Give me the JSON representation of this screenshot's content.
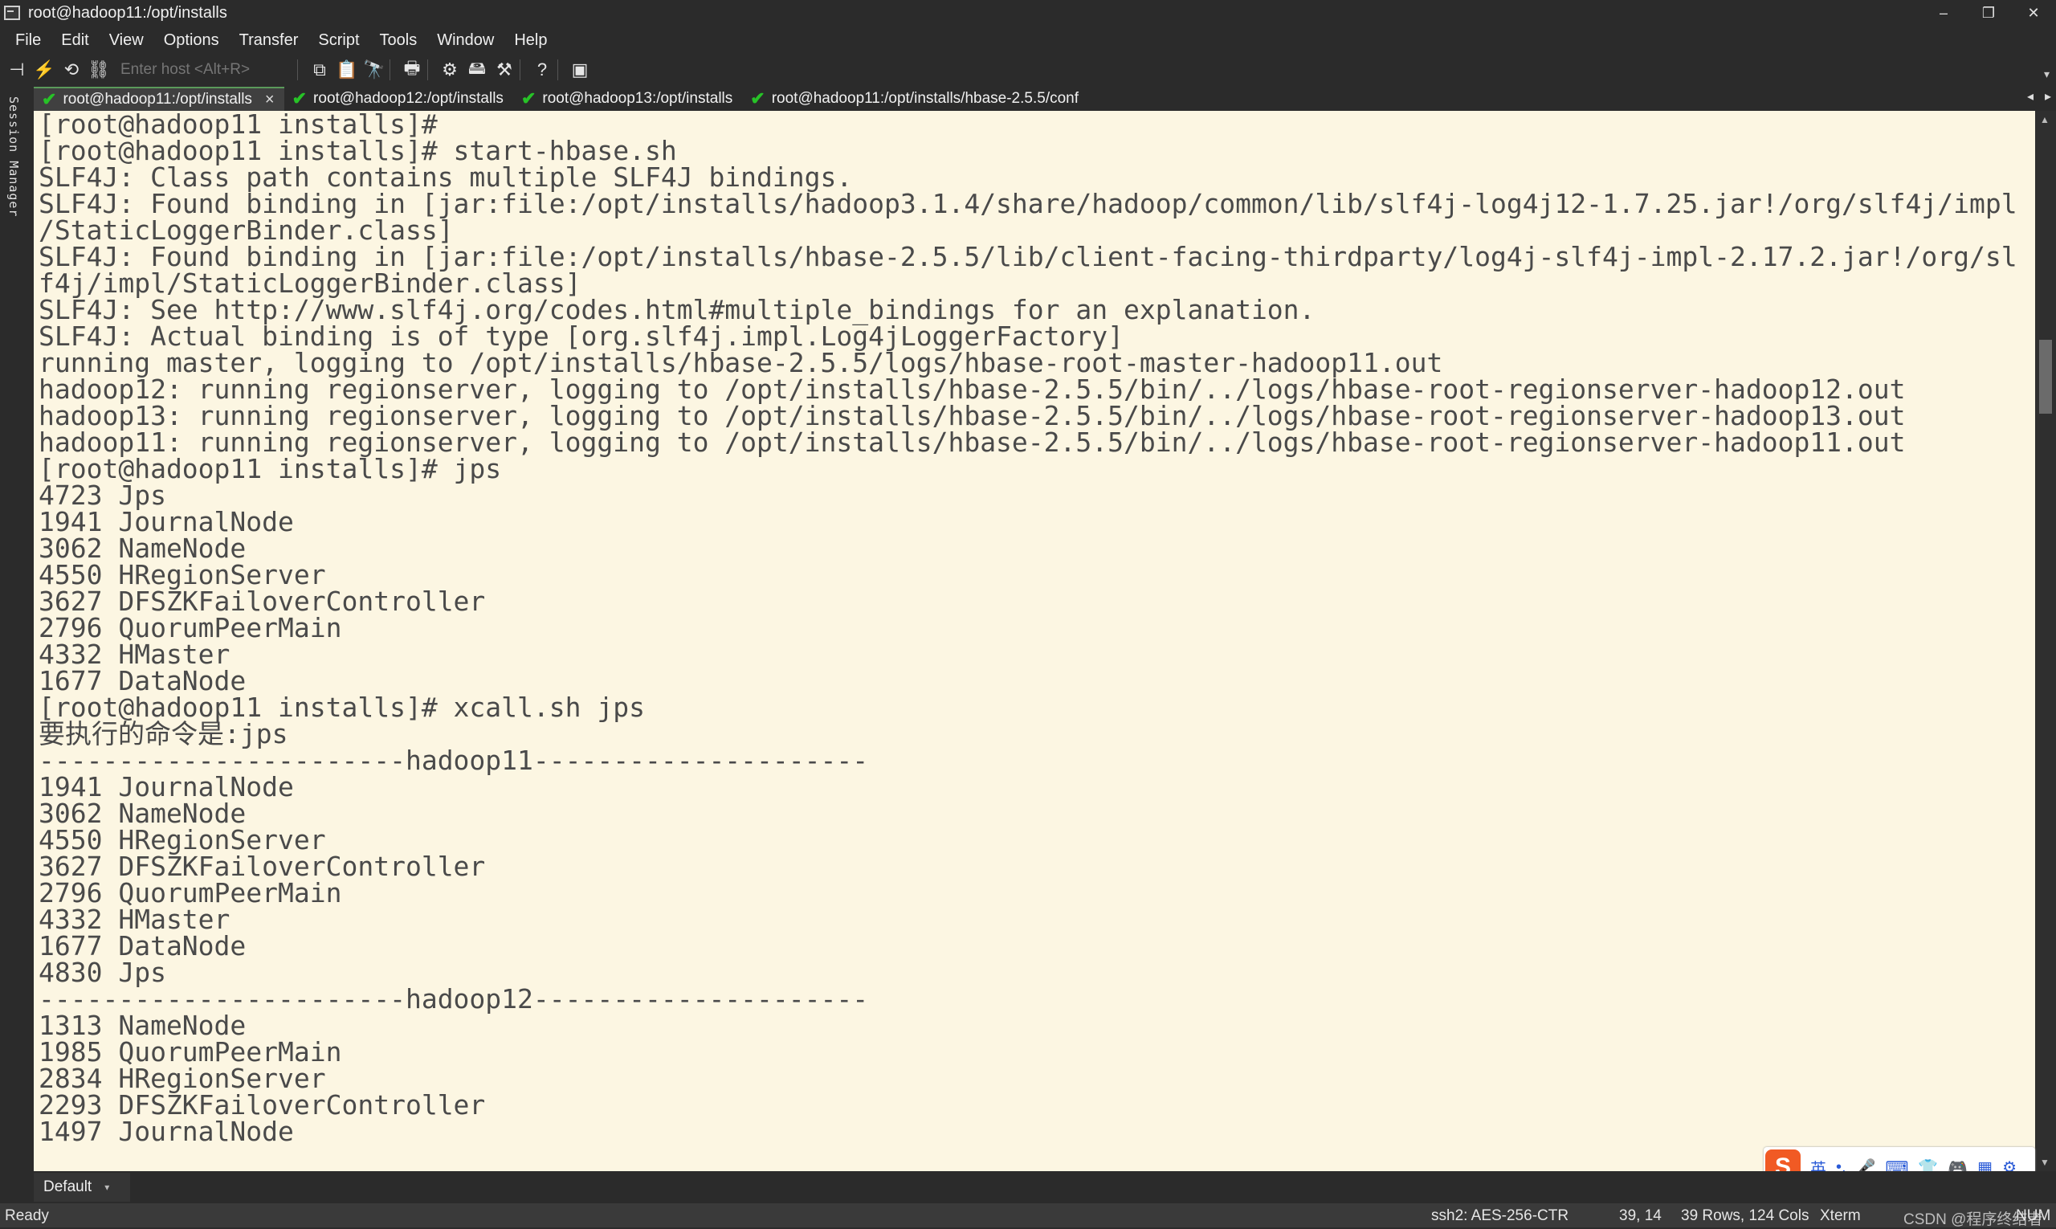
{
  "window": {
    "title": "root@hadoop11:/opt/installs",
    "controls": [
      "–",
      "❐",
      "✕"
    ]
  },
  "menu": [
    "File",
    "Edit",
    "View",
    "Options",
    "Transfer",
    "Script",
    "Tools",
    "Window",
    "Help"
  ],
  "toolbar": {
    "host_placeholder": "Enter host <Alt+R>",
    "more": "▾"
  },
  "sidebar": {
    "label": "Session Manager"
  },
  "tabs": [
    {
      "label": "root@hadoop11:/opt/installs",
      "active": true,
      "close": "×"
    },
    {
      "label": "root@hadoop12:/opt/installs",
      "active": false
    },
    {
      "label": "root@hadoop13:/opt/installs",
      "active": false
    },
    {
      "label": "root@hadoop11:/opt/installs/hbase-2.5.5/conf",
      "active": false
    }
  ],
  "tab_nav": {
    "prev": "◂",
    "next": "▸"
  },
  "terminal": {
    "lines": [
      "[root@hadoop11 installs]#",
      "[root@hadoop11 installs]# start-hbase.sh",
      "SLF4J: Class path contains multiple SLF4J bindings.",
      "SLF4J: Found binding in [jar:file:/opt/installs/hadoop3.1.4/share/hadoop/common/lib/slf4j-log4j12-1.7.25.jar!/org/slf4j/impl",
      "/StaticLoggerBinder.class]",
      "SLF4J: Found binding in [jar:file:/opt/installs/hbase-2.5.5/lib/client-facing-thirdparty/log4j-slf4j-impl-2.17.2.jar!/org/sl",
      "f4j/impl/StaticLoggerBinder.class]",
      "SLF4J: See http://www.slf4j.org/codes.html#multiple_bindings for an explanation.",
      "SLF4J: Actual binding is of type [org.slf4j.impl.Log4jLoggerFactory]",
      "running master, logging to /opt/installs/hbase-2.5.5/logs/hbase-root-master-hadoop11.out",
      "hadoop12: running regionserver, logging to /opt/installs/hbase-2.5.5/bin/../logs/hbase-root-regionserver-hadoop12.out",
      "hadoop13: running regionserver, logging to /opt/installs/hbase-2.5.5/bin/../logs/hbase-root-regionserver-hadoop13.out",
      "hadoop11: running regionserver, logging to /opt/installs/hbase-2.5.5/bin/../logs/hbase-root-regionserver-hadoop11.out",
      "[root@hadoop11 installs]# jps",
      "4723 Jps",
      "1941 JournalNode",
      "3062 NameNode",
      "4550 HRegionServer",
      "3627 DFSZKFailoverController",
      "2796 QuorumPeerMain",
      "4332 HMaster",
      "1677 DataNode",
      "[root@hadoop11 installs]# xcall.sh jps",
      "要执行的命令是:jps",
      "-----------------------hadoop11---------------------",
      "1941 JournalNode",
      "3062 NameNode",
      "4550 HRegionServer",
      "3627 DFSZKFailoverController",
      "2796 QuorumPeerMain",
      "4332 HMaster",
      "1677 DataNode",
      "4830 Jps",
      "-----------------------hadoop12---------------------",
      "1313 NameNode",
      "1985 QuorumPeerMain",
      "2834 HRegionServer",
      "2293 DFSZKFailoverController",
      "1497 JournalNode"
    ]
  },
  "ime": {
    "logo": "S",
    "items": [
      "英",
      "•,",
      "🎤",
      "⌨",
      "👕",
      "🎮",
      "▦",
      "⚙"
    ]
  },
  "bottom": {
    "session_tab": "Default",
    "arrow": "▾"
  },
  "status": {
    "ready": "Ready",
    "cipher": "ssh2: AES-256-CTR",
    "cursor": "39, 14",
    "size": "39 Rows, 124 Cols",
    "term": "Xterm",
    "watermark": "CSDN @程序终结者",
    "num": "NUM"
  }
}
